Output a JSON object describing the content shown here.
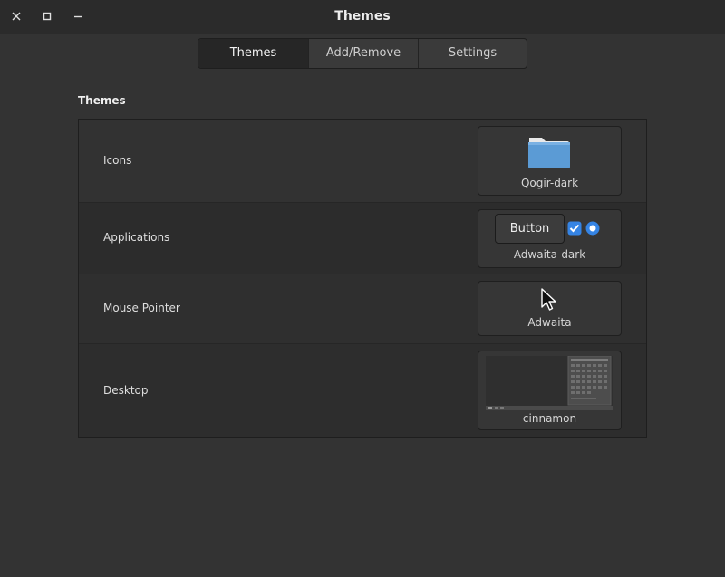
{
  "window": {
    "title": "Themes"
  },
  "tabs": [
    {
      "label": "Themes",
      "active": true
    },
    {
      "label": "Add/Remove",
      "active": false
    },
    {
      "label": "Settings",
      "active": false
    }
  ],
  "section": {
    "title": "Themes"
  },
  "rows": [
    {
      "label": "Icons",
      "value": "Qogir-dark",
      "preview": "folder-icon"
    },
    {
      "label": "Applications",
      "value": "Adwaita-dark",
      "preview_button": "Button"
    },
    {
      "label": "Mouse Pointer",
      "value": "Adwaita",
      "preview": "cursor-icon"
    },
    {
      "label": "Desktop",
      "value": "cinnamon",
      "preview": "desktop-thumbnail"
    }
  ],
  "colors": {
    "accent": "#3584e4",
    "folder": "#5b9bd5"
  }
}
